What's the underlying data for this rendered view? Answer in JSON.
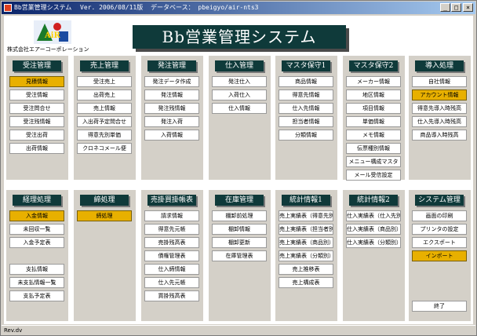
{
  "window": {
    "title": "Bb営業管理システム",
    "version": "Ver. 2006/08/11版",
    "database": "データベース： pbeigyo/air-nts3",
    "buttons": [
      "_",
      "□",
      "×"
    ]
  },
  "company": "株式会社エアーコーポレーション",
  "banner": "Bb営業管理システム",
  "logo_text": "AiR",
  "top_panels": [
    {
      "title": "受注管理",
      "items": [
        "見積情報",
        "受注情報",
        "受注問合せ",
        "受注残情報",
        "受注出荷",
        "出荷情報"
      ]
    },
    {
      "title": "売上管理",
      "items": [
        "受注売上",
        "出荷売上",
        "売上情報",
        "入出荷予定問合せ",
        "得意先別単価",
        "クロネコメール便"
      ]
    },
    {
      "title": "発注管理",
      "items": [
        "発注データ作成",
        "発注情報",
        "発注残情報",
        "発注入荷",
        "入荷情報"
      ]
    },
    {
      "title": "仕入管理",
      "items": [
        "発注仕入",
        "入荷仕入",
        "仕入情報"
      ]
    },
    {
      "title": "マスタ保守1",
      "items": [
        "商品情報",
        "得意先情報",
        "仕入先情報",
        "担当者情報",
        "分類情報"
      ]
    },
    {
      "title": "マスタ保守2",
      "items": [
        "メーカー情報",
        "地区情報",
        "項目情報",
        "単価情報",
        "メモ情報",
        "伝票種別情報",
        "メニュー構成マスタ",
        "メール受信設定"
      ]
    },
    {
      "title": "導入処理",
      "items": [
        "自社情報",
        "アカウント情報",
        "得意先導入時残高",
        "仕入先導入時残高",
        "商品導入時残高"
      ]
    }
  ],
  "bottom_panels": [
    {
      "title": "経理処理",
      "items": [
        "入金情報",
        "未回収一覧",
        "入金予定表",
        "",
        "支払情報",
        "未支払情報一覧",
        "支払予定表"
      ]
    },
    {
      "title": "締処理",
      "items": [
        "締処理"
      ]
    },
    {
      "title": "売掛買掛帳表",
      "items": [
        "請求情報",
        "得意先元帳",
        "売掛残高表",
        "債権管理表",
        "仕入締情報",
        "仕入先元帳",
        "買掛残高表"
      ]
    },
    {
      "title": "在庫管理",
      "items": [
        "棚卸前処理",
        "棚卸情報",
        "棚卸更新",
        "在庫管理表"
      ]
    },
    {
      "title": "統計情報1",
      "items": [
        "売上実績表（得意先別）",
        "売上実績表（担当者別）",
        "売上実績表（商品別）",
        "売上実績表（分類別）",
        "売上推移表",
        "売上構成表"
      ]
    },
    {
      "title": "統計情報2",
      "items": [
        "仕入実績表（仕入先別）",
        "仕入実績表（商品別）",
        "仕入実績表（分類別）"
      ]
    },
    {
      "title": "システム管理",
      "items": [
        "画面の印刷",
        "プリンタの設定",
        "エクスポート",
        "インポート"
      ],
      "exit": "終了"
    }
  ],
  "status_text": "Rev.dv",
  "colors": {
    "highlight": "#e8b000",
    "header_bg": "#0f3a3a",
    "title_bar": "#0a246a"
  }
}
